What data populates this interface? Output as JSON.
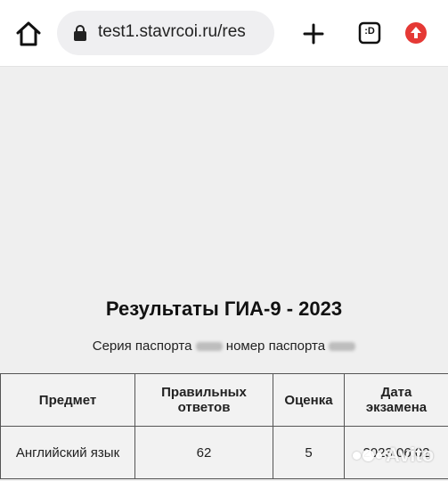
{
  "browser": {
    "url": "test1.stavrcoi.ru/res",
    "tabs_label": ":D"
  },
  "page": {
    "title": "Результаты ГИА-9 - 2023",
    "passport_series_label": "Серия паспорта",
    "passport_number_label": "номер паспорта"
  },
  "table": {
    "headers": {
      "subject": "Предмет",
      "correct": "Правильных ответов",
      "grade": "Оценка",
      "date": "Дата экзамена"
    },
    "rows": [
      {
        "subject": "Английский язык",
        "correct": "62",
        "grade": "5",
        "date": "2023.06.02"
      }
    ]
  },
  "watermark": "Avito",
  "icons": [
    "home-icon",
    "lock-icon",
    "plus-icon",
    "tabs-icon",
    "update-icon"
  ],
  "colors": {
    "update_accent": "#e53935",
    "background": "#efefef"
  }
}
